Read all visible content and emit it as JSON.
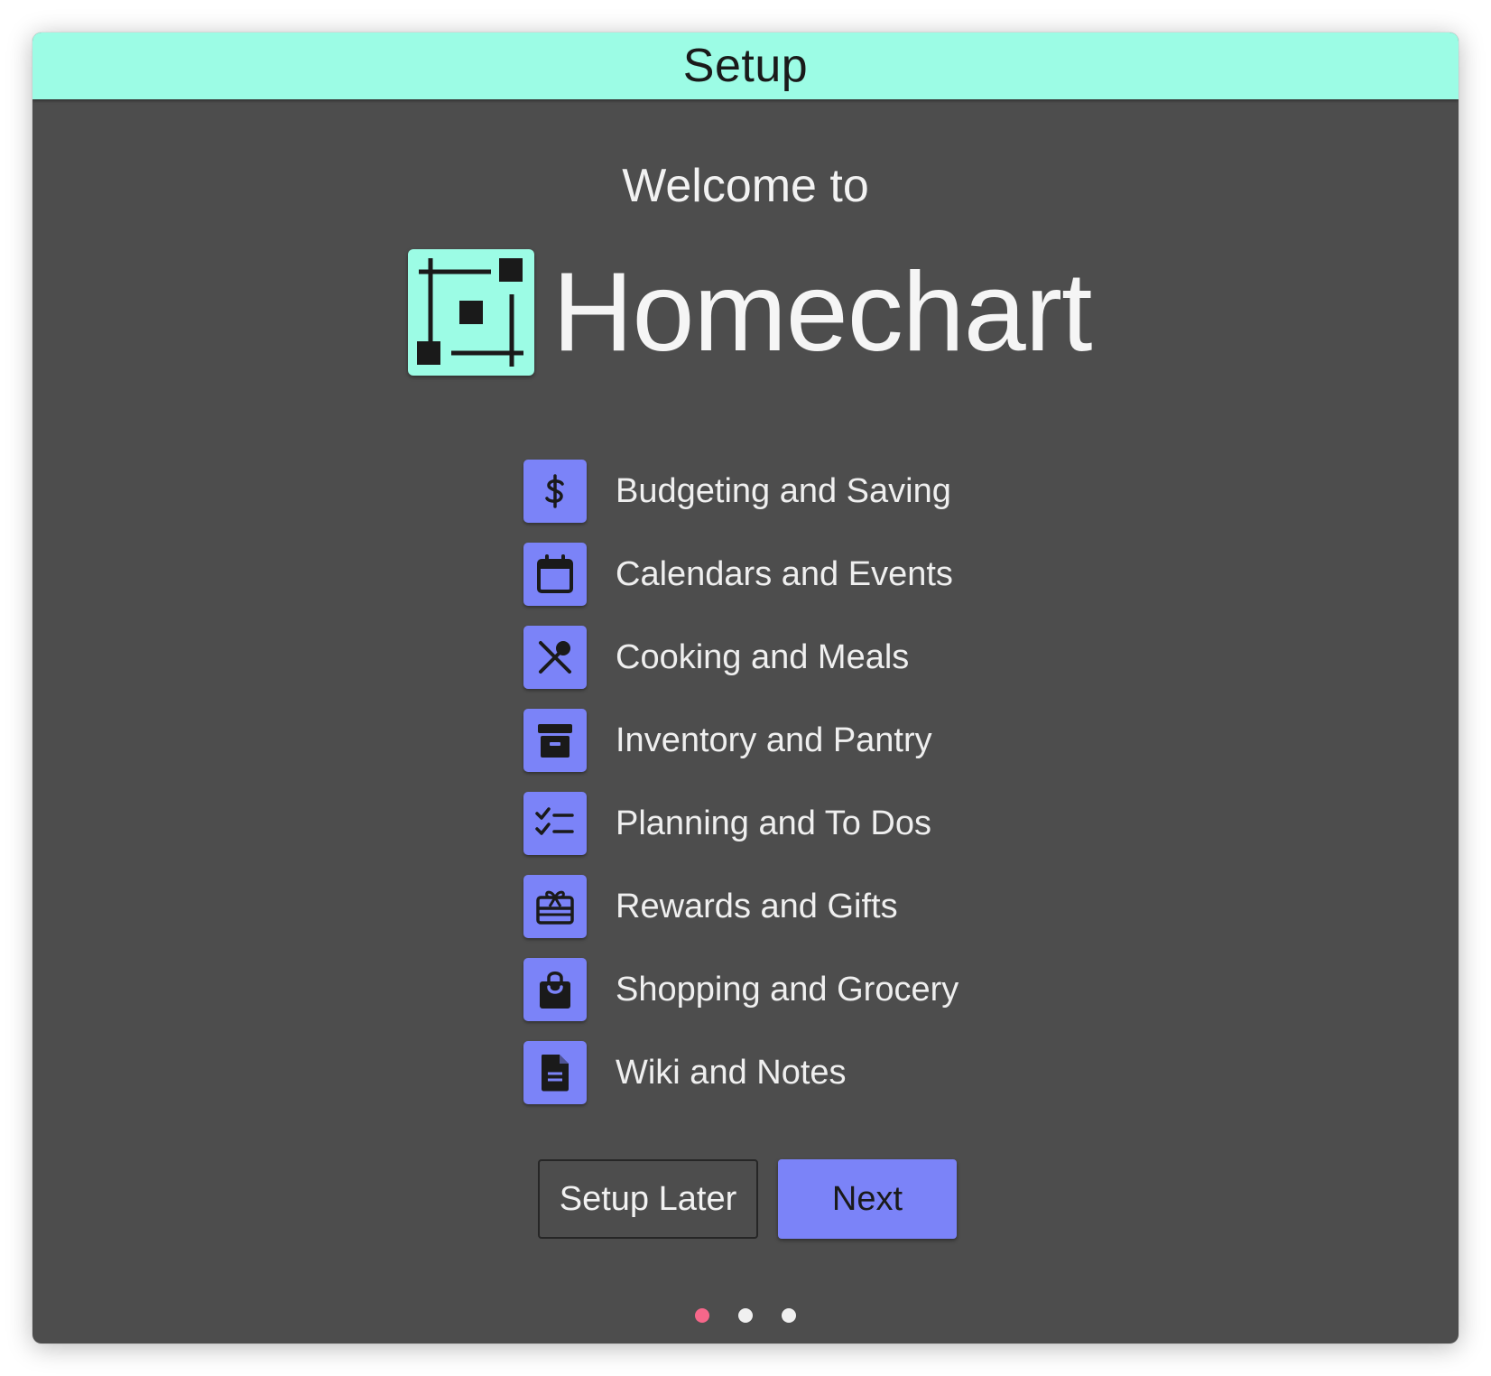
{
  "window": {
    "title": "Setup"
  },
  "welcome": {
    "intro": "Welcome to",
    "app_name": "Homechart"
  },
  "features": [
    {
      "label": "Budgeting and Saving",
      "icon": "dollar-icon"
    },
    {
      "label": "Calendars and Events",
      "icon": "calendar-icon"
    },
    {
      "label": "Cooking and Meals",
      "icon": "utensils-icon"
    },
    {
      "label": "Inventory and Pantry",
      "icon": "archive-box-icon"
    },
    {
      "label": "Planning and To Dos",
      "icon": "checklist-icon"
    },
    {
      "label": "Rewards and Gifts",
      "icon": "gift-card-icon"
    },
    {
      "label": "Shopping and Grocery",
      "icon": "shopping-bag-icon"
    },
    {
      "label": "Wiki and Notes",
      "icon": "document-icon"
    }
  ],
  "actions": {
    "setup_later": "Setup Later",
    "next": "Next"
  },
  "pagination": {
    "total": 3,
    "current": 1
  },
  "colors": {
    "titlebar": "#9cfce5",
    "background": "#4d4d4d",
    "accent": "#7b83f8",
    "active_dot": "#f6678a"
  }
}
